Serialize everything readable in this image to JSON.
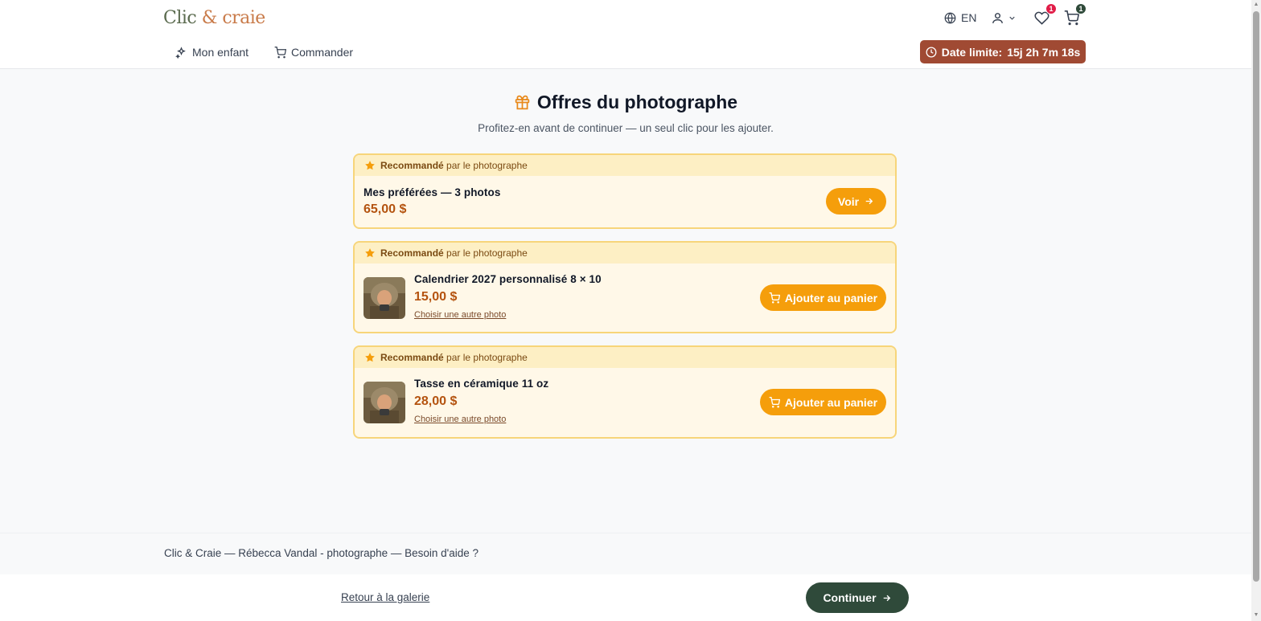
{
  "header": {
    "logo_part1": "Clic",
    "logo_amp": " & ",
    "logo_part2": "craie",
    "language": "EN",
    "favorites_count": "1",
    "cart_count": "1"
  },
  "nav": {
    "items": [
      {
        "label": "Mon enfant",
        "icon": "sparkles-icon"
      },
      {
        "label": "Commander",
        "icon": "cart-icon"
      }
    ],
    "deadline_label": "Date limite:",
    "deadline_value": "15j 2h 7m 18s"
  },
  "main": {
    "title": "Offres du photographe",
    "subtitle": "Profitez‑en avant de continuer — un seul clic pour les ajouter.",
    "offers": [
      {
        "badge_bold": "Recommandé",
        "badge_rest": "par le photographe",
        "name": "Mes préférées — 3 photos",
        "price": "65,00 $",
        "button": "Voir"
      },
      {
        "badge_bold": "Recommandé",
        "badge_rest": "par le photographe",
        "name": "Calendrier 2027 personnalisé 8 × 10",
        "price": "15,00 $",
        "link": "Choisir une autre photo",
        "button": "Ajouter au panier"
      },
      {
        "badge_bold": "Recommandé",
        "badge_rest": "par le photographe",
        "name": "Tasse en céramique 11 oz",
        "price": "28,00 $",
        "link": "Choisir une autre photo",
        "button": "Ajouter au panier"
      }
    ]
  },
  "footer": {
    "text": "Clic & Craie — Rébecca Vandal - photographe — Besoin d'aide ?",
    "back_link": "Retour à la galerie",
    "continue": "Continuer"
  },
  "colors": {
    "accent": "#f59e0b",
    "price": "#b4530f",
    "deadline_bg": "#a04a33",
    "primary_dark": "#2f4a3a"
  }
}
